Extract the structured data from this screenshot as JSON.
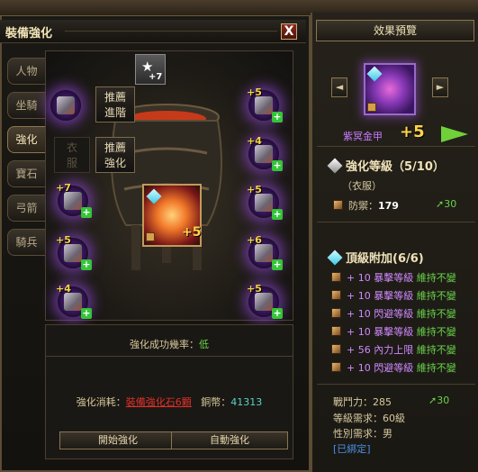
{
  "window": {
    "title": "裝備強化",
    "close_label": "X"
  },
  "tabs": [
    {
      "label": "人物",
      "active": false
    },
    {
      "label": "坐騎",
      "active": false
    },
    {
      "label": "強化",
      "active": true
    },
    {
      "label": "寶石",
      "active": false
    },
    {
      "label": "弓箭",
      "active": false
    },
    {
      "label": "騎兵",
      "active": false
    }
  ],
  "recommend": {
    "advance_line1": "推薦",
    "advance_line2": "進階",
    "enhance_line1": "推薦",
    "enhance_line2": "強化",
    "slot_label_line1": "衣",
    "slot_label_line2": "服"
  },
  "top_slot_level": "+7",
  "slots_left": [
    {
      "level": "+7"
    },
    {
      "level": "+5"
    },
    {
      "level": "+4"
    }
  ],
  "slots_right": [
    {
      "level": "+5"
    },
    {
      "level": "+4"
    },
    {
      "level": "+5"
    },
    {
      "level": "+6"
    },
    {
      "level": "+5"
    }
  ],
  "center_level": "+5",
  "bottom": {
    "rate_label": "強化成功幾率：",
    "rate_value": "低",
    "cost_label": "強化消耗：",
    "cost_item": "裝備強化石6顆",
    "coin_label": "銅幣：",
    "coin_value": "41313",
    "start_button": "開始強化",
    "auto_button": "自動強化"
  },
  "preview": {
    "title": "效果預覽",
    "prev_arrow": "◄",
    "next_arrow": "►",
    "item_name": "紫冥金甲",
    "item_level": "+5",
    "enhance_header": "強化等級（5/10）",
    "slot_type": "（衣服）",
    "defense_label": "防禦：",
    "defense_value": "179",
    "defense_bonus": "30",
    "top_header": "頂級附加(6/6)",
    "attributes": [
      {
        "text": "+ 10 暴擊等級",
        "status": "維持不變"
      },
      {
        "text": "+ 10 暴擊等級",
        "status": "維持不變"
      },
      {
        "text": "+ 10 閃避等級",
        "status": "維持不變"
      },
      {
        "text": "+ 10 暴擊等級",
        "status": "維持不變"
      },
      {
        "text": "+ 56 內力上限",
        "status": "維持不變"
      },
      {
        "text": "+ 10 閃避等級",
        "status": "維持不變"
      }
    ],
    "power_label": "戰鬥力：",
    "power_value": "285",
    "power_bonus": "30",
    "req_level": "等級需求：60級",
    "req_gender": "性別需求：男",
    "bound": "[已綁定]"
  },
  "colors": {
    "accent_gold": "#ffd34a",
    "purple_glow": "#a850ff",
    "keep_green": "#6ad34a",
    "cost_red": "#e0302a"
  }
}
